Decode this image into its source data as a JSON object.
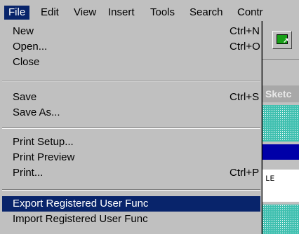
{
  "menubar": {
    "items": [
      {
        "label": "File",
        "active": true
      },
      {
        "label": "Edit"
      },
      {
        "label": "View"
      },
      {
        "label": "Insert"
      },
      {
        "label": "Tools"
      },
      {
        "label": "Search"
      },
      {
        "label": "Contr"
      }
    ]
  },
  "file_menu": {
    "new": {
      "label": "New",
      "shortcut": "Ctrl+N"
    },
    "open": {
      "label": "Open...",
      "shortcut": "Ctrl+O"
    },
    "close": {
      "label": "Close"
    },
    "save": {
      "label": "Save",
      "shortcut": "Ctrl+S"
    },
    "save_as": {
      "label": "Save As..."
    },
    "print_setup": {
      "label": "Print Setup..."
    },
    "print_preview": {
      "label": "Print Preview"
    },
    "print": {
      "label": "Print...",
      "shortcut": "Ctrl+P"
    },
    "export_func": {
      "label": "Export Registered User Func",
      "highlighted": true
    },
    "import_func": {
      "label": "Import Registered User Func"
    }
  },
  "background": {
    "sketch_tab_label": "Sketc",
    "field_text": "LE",
    "toolbar_icon": "green-arrow-icon"
  },
  "colors": {
    "menu_bg": "#c0c0c0",
    "highlight": "#08246b",
    "title_blue": "#0000a8",
    "teal_pattern": "#40c0b0"
  }
}
